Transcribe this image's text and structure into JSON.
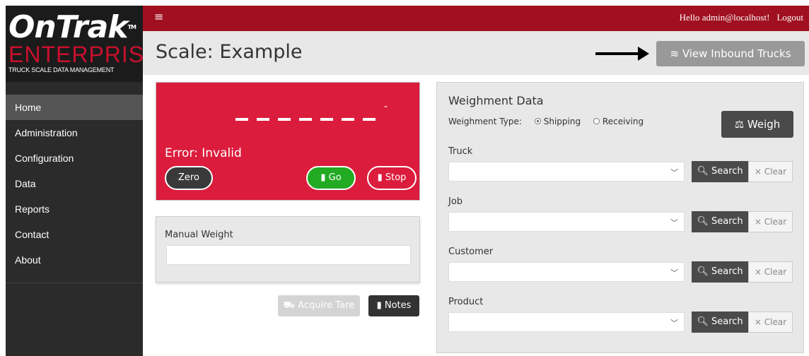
{
  "brand": {
    "name": "OnTrak",
    "tm": "TM",
    "edition": "ENTERPRISE",
    "tagline": "TRUCK SCALE DATA MANAGEMENT"
  },
  "sidebar": {
    "items": [
      {
        "label": "Home",
        "active": true
      },
      {
        "label": "Administration"
      },
      {
        "label": "Configuration"
      },
      {
        "label": "Data"
      },
      {
        "label": "Reports"
      },
      {
        "label": "Contact"
      },
      {
        "label": "About"
      }
    ]
  },
  "topbar": {
    "menu_icon": "hamburger-icon",
    "hello": "Hello admin@localhost!",
    "logout": "Logout"
  },
  "header": {
    "title": "Scale: Example",
    "inbound_button": "View Inbound Trucks",
    "inbound_icon": "layers-icon"
  },
  "scale": {
    "minus": "-",
    "error": "Error: Invalid",
    "zero": "Zero",
    "go": "Go",
    "stop": "Stop",
    "panel_color": "#dc1c3c"
  },
  "manual": {
    "label": "Manual Weight",
    "value": ""
  },
  "actions": {
    "acquire_tare": "Acquire Tare",
    "notes": "Notes"
  },
  "weighment": {
    "title": "Weighment Data",
    "type_label": "Weighment Type:",
    "options": [
      "Shipping",
      "Receiving"
    ],
    "selected": "Shipping",
    "weigh_button": "Weigh",
    "fields": [
      {
        "label": "Truck",
        "value": ""
      },
      {
        "label": "Job",
        "value": ""
      },
      {
        "label": "Customer",
        "value": ""
      },
      {
        "label": "Product",
        "value": ""
      }
    ],
    "search_label": "Search",
    "clear_label": "Clear"
  }
}
